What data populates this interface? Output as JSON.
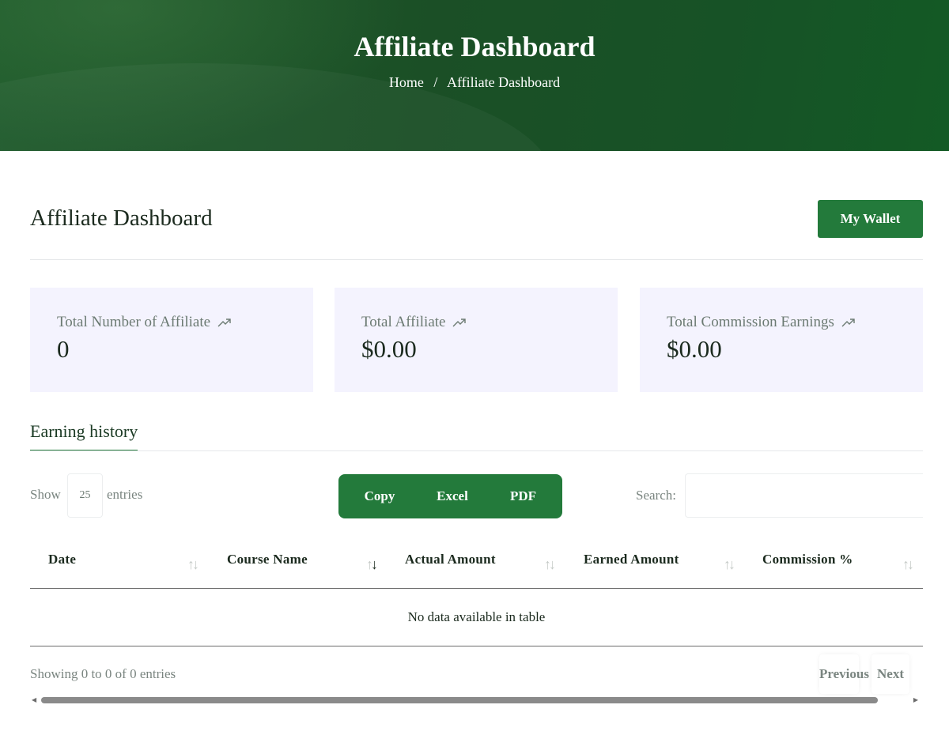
{
  "hero": {
    "title": "Affiliate Dashboard",
    "breadcrumb": {
      "home": "Home",
      "separator": "/",
      "current": "Affiliate Dashboard"
    }
  },
  "page": {
    "heading": "Affiliate Dashboard",
    "wallet_button": "My Wallet"
  },
  "stats": [
    {
      "label": "Total Number of Affiliate",
      "value": "0",
      "icon": "trend-up-icon"
    },
    {
      "label": "Total Affiliate",
      "value": "$0.00",
      "icon": "trend-up-icon"
    },
    {
      "label": "Total Commission Earnings",
      "value": "$0.00",
      "icon": "trend-up-icon"
    }
  ],
  "tabs": {
    "earning_history": "Earning history"
  },
  "table_controls": {
    "show_label": "Show",
    "entries_value": "25",
    "entries_label": "entries",
    "export_buttons": [
      "Copy",
      "Excel",
      "PDF"
    ],
    "search_label": "Search:",
    "search_value": ""
  },
  "table": {
    "columns": [
      "Date",
      "Course Name",
      "Actual Amount",
      "Earned Amount",
      "Commission %"
    ],
    "empty_message": "No data available in table",
    "info": "Showing 0 to 0 of 0 entries",
    "pagination": {
      "previous": "Previous",
      "next": "Next"
    }
  },
  "colors": {
    "hero": "#1b4f26",
    "accent": "#237a3b",
    "card_bg": "#f4f3fe"
  }
}
